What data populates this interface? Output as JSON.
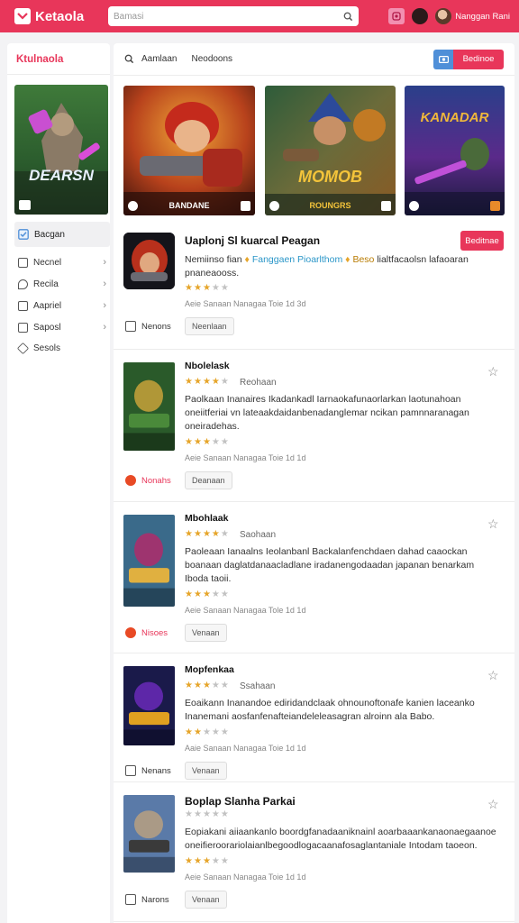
{
  "app": {
    "name": "Ketaola",
    "accent": "#e8365a",
    "accent2": "#4f8fd8"
  },
  "search": {
    "placeholder": "Bamasi"
  },
  "user": {
    "name": "Nanggan Rani"
  },
  "sidebar": {
    "title": "Ktulnaola",
    "banner_title": "DEARSN",
    "active": "Bacgan",
    "items": [
      {
        "label": "Necnel",
        "icon": "calendar-icon",
        "chevron": true
      },
      {
        "label": "Recila",
        "icon": "pin-icon",
        "chevron": true
      },
      {
        "label": "Aapriel",
        "icon": "board-icon",
        "chevron": true
      },
      {
        "label": "Saposl",
        "icon": "gallery-icon",
        "chevron": true
      },
      {
        "label": "Sesols",
        "icon": "diamond-icon",
        "chevron": false
      }
    ]
  },
  "toolbar": {
    "filter": "Aamlaan",
    "sort": "Neodoons",
    "action": "Bedinoe"
  },
  "banners": [
    {
      "caption": "BANDANE"
    },
    {
      "title": "MOMOB",
      "caption": "ROUNGRS"
    },
    {
      "title": "KANADAR"
    }
  ],
  "featured": {
    "title": "Uaplonj Sl kuarcal Peagan",
    "desc_prefix": "Nemiinso fian",
    "desc_mid": "Fanggaen Pioarlthom",
    "desc_mid2": "Beso",
    "desc_suffix": "lialtfacaolsn lafaoaran",
    "desc_line2": "pnaneaooss.",
    "rating": 3,
    "meta": "Aeie Sanaan Nanagaa Toie 1d 3d",
    "tag": "Neenlaan",
    "source": "Nenons",
    "action": "Beditnae"
  },
  "listings": [
    {
      "name": "Nbolelask",
      "sub": "Reohaan",
      "rating": 4,
      "lines": [
        "Paolkaan  Inanaires  Ikadankadl  Iarnaokafunaorlarkan  laotunahoan",
        "oneiitferiai  vn  lateaakdaidanbenadanglemar  ncikan  pamnnaranagan",
        "oneiradehas."
      ],
      "rating2": 3,
      "meta": "Aeie Sanaan Nanagaa Toie 1d 1d",
      "source": "Nonahs",
      "tag": "Deanaan"
    },
    {
      "name": "Mbohlaak",
      "sub": "Saohaan",
      "rating": 4,
      "lines": [
        "Paoleaan  Ianaalns  Ieolanbanl  Backalanfenchdaen  dahad  caaockan",
        "boanaan  daglatdanaacladlane  iradanengodaadan  japanan  benarkam",
        "Iboda taoii."
      ],
      "rating2": 3,
      "meta": "Aeie Sanaan Nanagaa Tole 1d 1d",
      "source": "Nisoes",
      "tag": "Venaan"
    },
    {
      "name": "Mopfenkaa",
      "sub": "Ssahaan",
      "rating": 3,
      "lines": [
        "Eoaikann  Inanandoe  ediridandclaak  ohnounoftonafe  kanien  laceanko",
        "Inanemani  aosfanfenafteiandeleleasagran  alroinn  ala  Babo."
      ],
      "rating2": 2,
      "meta": "Aaie Sanaan Nanagaa Toie 1d 1d",
      "source": "Nenans",
      "tag": "Venaan"
    },
    {
      "name": "Boplap Slanha Parkai",
      "sub": "",
      "rating": 0,
      "lines": [
        "Eopiakani  aiiaankanlo  boordgfanadaaniknainl  aoarbaaankanaonaegaanoe",
        "oneifieroorariolaianlbegoodlogacaanafosaglantaniale  Intodam  taoeon."
      ],
      "rating2": 3,
      "meta": "Aeie Sanaan Nanagaa Toie 1d 1d",
      "source": "Narons",
      "tag": "Venaan"
    }
  ]
}
